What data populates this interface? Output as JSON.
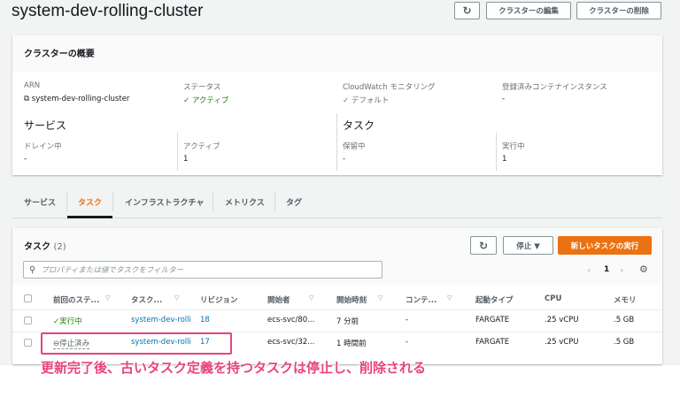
{
  "header": {
    "title": "system-dev-rolling-cluster",
    "refresh_icon": "refresh-icon",
    "edit_label": "クラスターの編集",
    "delete_label": "クラスターの削除"
  },
  "overview": {
    "title": "クラスターの概要",
    "arn_label": "ARN",
    "arn_value": "system-dev-rolling-cluster",
    "status_label": "ステータス",
    "status_value": "アクティブ",
    "cloudwatch_label": "CloudWatch モニタリング",
    "cloudwatch_value": "デフォルト",
    "instances_label": "登録済みコンテナインスタンス",
    "instances_value": "-",
    "services_heading": "サービス",
    "draining_label": "ドレイン中",
    "draining_value": "-",
    "active_label": "アクティブ",
    "active_value": "1",
    "tasks_heading": "タスク",
    "pending_label": "保留中",
    "pending_value": "-",
    "running_label": "実行中",
    "running_value": "1"
  },
  "tabs": [
    {
      "label": "サービス"
    },
    {
      "label": "タスク",
      "active": true
    },
    {
      "label": "インフラストラクチャ"
    },
    {
      "label": "メトリクス"
    },
    {
      "label": "タグ"
    }
  ],
  "tasks": {
    "title": "タスク",
    "count": "(2)",
    "stop_label": "停止 ▼",
    "run_label": "新しいタスクの実行",
    "filter_placeholder": "プロパティまたは値でタスクをフィルター",
    "page": "1",
    "columns": [
      "前回のステ...",
      "タスク...",
      "リビジョン",
      "開始者",
      "開始時刻",
      "コンテ...",
      "起動タイプ",
      "CPU",
      "メモリ"
    ],
    "rows": [
      {
        "status": "実行中",
        "task": "system-dev-rolli",
        "revision": "18",
        "started_by": "ecs-svc/80...",
        "started_at": "7 分前",
        "container": "-",
        "launch_type": "FARGATE",
        "cpu": ".25 vCPU",
        "memory": ".5 GB"
      },
      {
        "status": "停止済み",
        "task": "system-dev-rolli",
        "revision": "17",
        "started_by": "ecs-svc/32...",
        "started_at": "1 時間前",
        "container": "-",
        "launch_type": "FARGATE",
        "cpu": ".25 vCPU",
        "memory": ".5 GB"
      }
    ]
  },
  "annotation": "更新完了後、古いタスク定義を持つタスクは停止し、削除される",
  "colors": {
    "accent": "#ec7211",
    "success": "#1d8102",
    "link": "#0073bb",
    "highlight": "#e8447d"
  }
}
